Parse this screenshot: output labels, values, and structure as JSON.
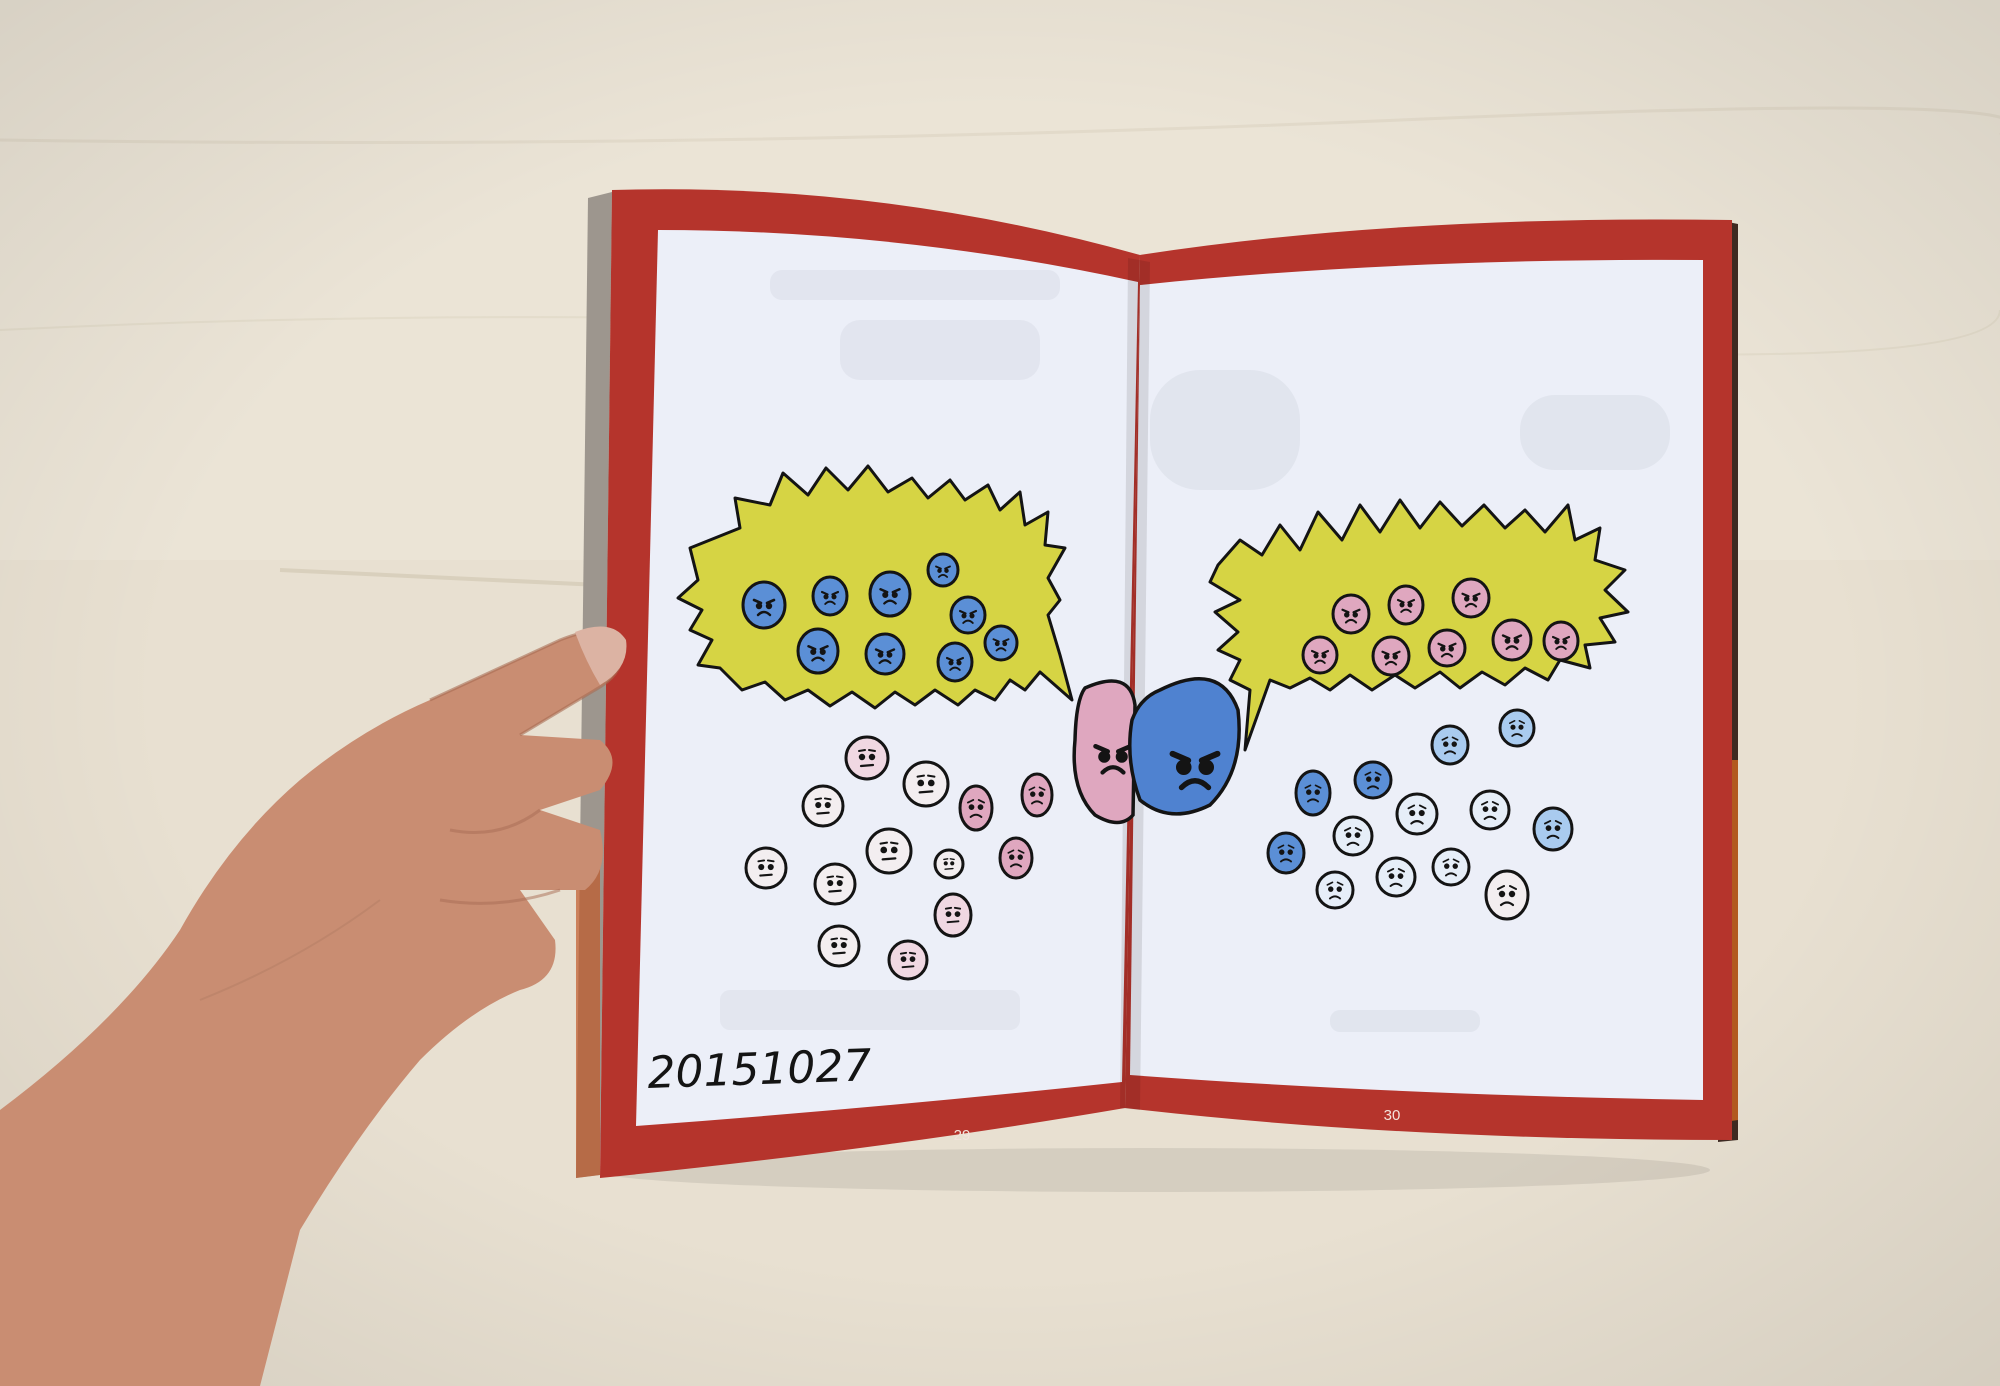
{
  "photo": {
    "subject": "open-zine-spread",
    "colors": {
      "table": "#ebe4d6",
      "cover_red": "#b5342c",
      "page": "#eceff8",
      "burst_yellow": "#d6d444",
      "blue_face": "#5b8fd6",
      "pink_face": "#dfa7bf",
      "light_blue_face": "#a9cbef",
      "pale_face": "#f3eef0",
      "ink": "#141414",
      "skin": "#c98d72"
    }
  },
  "book": {
    "left_page": {
      "handwritten_date": "20151027",
      "page_number": "29"
    },
    "right_page": {
      "page_number": "30"
    }
  }
}
